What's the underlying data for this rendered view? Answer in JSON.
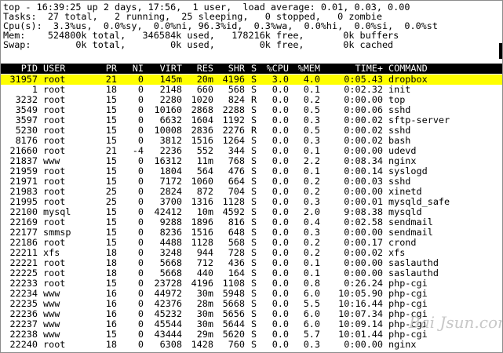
{
  "summary": [
    "top - 16:39:25 up 2 days, 17:56,  1 user,  load average: 0.01, 0.03, 0.00",
    "Tasks:  27 total,   2 running,  25 sleeping,   0 stopped,   0 zombie",
    "Cpu(s):  3.3%us,  0.0%sy,  0.0%ni, 96.3%id,  0.3%wa,  0.0%hi,  0.0%si,  0.0%st",
    "Mem:    524800k total,   346584k used,   178216k free,       0k buffers",
    "Swap:        0k total,        0k used,        0k free,       0k cached"
  ],
  "columns": [
    "PID",
    "USER",
    "PR",
    "NI",
    "VIRT",
    "RES",
    "SHR",
    "S",
    "%CPU",
    "%MEM",
    "TIME+",
    "COMMAND"
  ],
  "processes": [
    [
      "31957",
      "root",
      "21",
      "0",
      "145m",
      "20m",
      "4196",
      "S",
      "3.0",
      "4.0",
      "0:05.43",
      "dropbox"
    ],
    [
      "1",
      "root",
      "18",
      "0",
      "2148",
      "660",
      "568",
      "S",
      "0.0",
      "0.1",
      "0:02.32",
      "init"
    ],
    [
      "3232",
      "root",
      "15",
      "0",
      "2280",
      "1020",
      "824",
      "R",
      "0.0",
      "0.2",
      "0:00.00",
      "top"
    ],
    [
      "3549",
      "root",
      "15",
      "0",
      "10160",
      "2868",
      "2288",
      "S",
      "0.0",
      "0.5",
      "0:00.06",
      "sshd"
    ],
    [
      "3597",
      "root",
      "15",
      "0",
      "6632",
      "1604",
      "1192",
      "S",
      "0.0",
      "0.3",
      "0:00.02",
      "sftp-server"
    ],
    [
      "5230",
      "root",
      "15",
      "0",
      "10008",
      "2836",
      "2276",
      "R",
      "0.0",
      "0.5",
      "0:00.02",
      "sshd"
    ],
    [
      "8176",
      "root",
      "15",
      "0",
      "3812",
      "1516",
      "1264",
      "S",
      "0.0",
      "0.3",
      "0:00.02",
      "bash"
    ],
    [
      "21660",
      "root",
      "21",
      "-4",
      "2236",
      "552",
      "344",
      "S",
      "0.0",
      "0.1",
      "0:00.00",
      "udevd"
    ],
    [
      "21837",
      "www",
      "15",
      "0",
      "16312",
      "11m",
      "768",
      "S",
      "0.0",
      "2.2",
      "0:08.34",
      "nginx"
    ],
    [
      "21959",
      "root",
      "15",
      "0",
      "1804",
      "564",
      "476",
      "S",
      "0.0",
      "0.1",
      "0:00.14",
      "syslogd"
    ],
    [
      "21971",
      "root",
      "15",
      "0",
      "7172",
      "1060",
      "664",
      "S",
      "0.0",
      "0.2",
      "0:00.03",
      "sshd"
    ],
    [
      "21983",
      "root",
      "25",
      "0",
      "2824",
      "872",
      "704",
      "S",
      "0.0",
      "0.2",
      "0:00.00",
      "xinetd"
    ],
    [
      "21995",
      "root",
      "25",
      "0",
      "3700",
      "1316",
      "1128",
      "S",
      "0.0",
      "0.3",
      "0:00.01",
      "mysqld_safe"
    ],
    [
      "22100",
      "mysql",
      "15",
      "0",
      "42412",
      "10m",
      "4592",
      "S",
      "0.0",
      "2.0",
      "9:08.38",
      "mysqld"
    ],
    [
      "22169",
      "root",
      "15",
      "0",
      "9288",
      "1896",
      "816",
      "S",
      "0.0",
      "0.4",
      "0:02.58",
      "sendmail"
    ],
    [
      "22177",
      "smmsp",
      "15",
      "0",
      "8236",
      "1516",
      "648",
      "S",
      "0.0",
      "0.3",
      "0:00.00",
      "sendmail"
    ],
    [
      "22186",
      "root",
      "15",
      "0",
      "4488",
      "1128",
      "568",
      "S",
      "0.0",
      "0.2",
      "0:00.17",
      "crond"
    ],
    [
      "22211",
      "xfs",
      "18",
      "0",
      "3248",
      "944",
      "728",
      "S",
      "0.0",
      "0.2",
      "0:00.02",
      "xfs"
    ],
    [
      "22221",
      "root",
      "18",
      "0",
      "5668",
      "712",
      "436",
      "S",
      "0.0",
      "0.1",
      "0:00.00",
      "saslauthd"
    ],
    [
      "22225",
      "root",
      "18",
      "0",
      "5668",
      "440",
      "164",
      "S",
      "0.0",
      "0.1",
      "0:00.00",
      "saslauthd"
    ],
    [
      "22233",
      "root",
      "15",
      "0",
      "23728",
      "4196",
      "1108",
      "S",
      "0.0",
      "0.8",
      "0:26.24",
      "php-cgi"
    ],
    [
      "22234",
      "www",
      "16",
      "0",
      "44972",
      "30m",
      "5948",
      "S",
      "0.0",
      "6.0",
      "10:05.90",
      "php-cgi"
    ],
    [
      "22235",
      "www",
      "16",
      "0",
      "42376",
      "28m",
      "5668",
      "S",
      "0.0",
      "5.5",
      "10:16.44",
      "php-cgi"
    ],
    [
      "22236",
      "www",
      "16",
      "0",
      "45232",
      "30m",
      "5656",
      "S",
      "0.0",
      "6.0",
      "10:07.34",
      "php-cgi"
    ],
    [
      "22237",
      "www",
      "16",
      "0",
      "45544",
      "30m",
      "5644",
      "S",
      "0.0",
      "6.0",
      "10:09.14",
      "php-cgi"
    ],
    [
      "22238",
      "www",
      "15",
      "0",
      "43444",
      "29m",
      "5620",
      "S",
      "0.0",
      "5.7",
      "10:01.44",
      "php-cgi"
    ],
    [
      "22240",
      "root",
      "18",
      "0",
      "6308",
      "1428",
      "760",
      "S",
      "0.0",
      "0.3",
      "0:00.00",
      "nginx"
    ]
  ],
  "highlight_color": "#ffff00",
  "watermark": "Bai Jsun.com"
}
